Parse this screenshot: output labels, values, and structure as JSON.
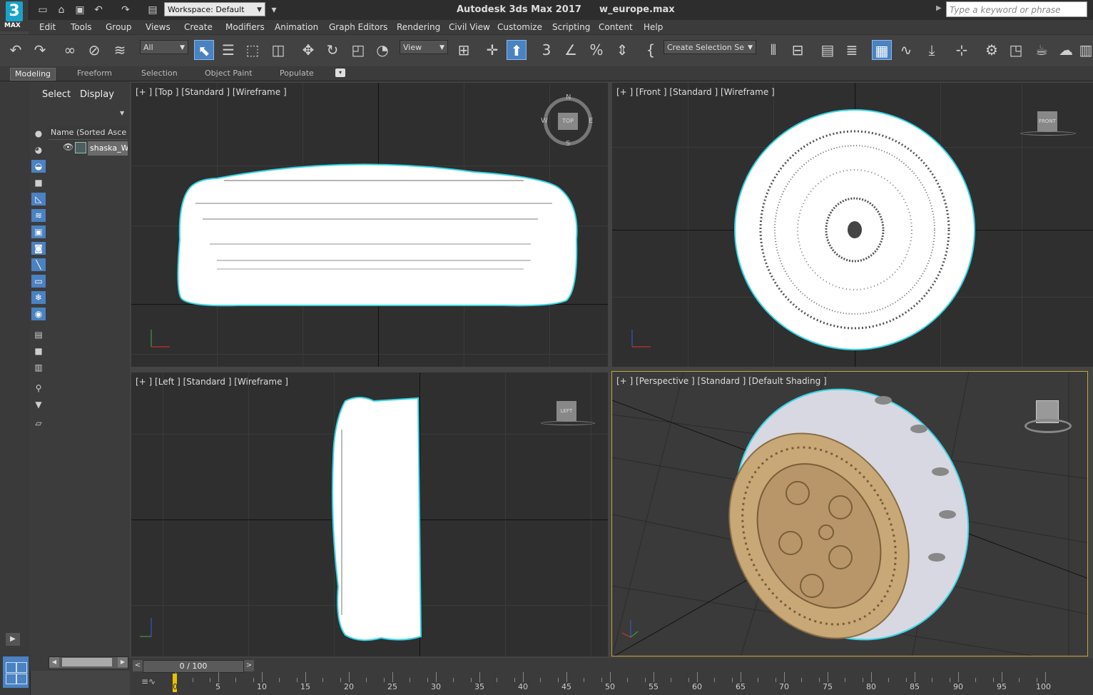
{
  "app": {
    "logo_number": "3",
    "logo_text": "MAX",
    "title": "Autodesk 3ds Max 2017",
    "filename": "w_europe.max",
    "workspace": "Workspace: Default",
    "search_placeholder": "Type a keyword or phrase"
  },
  "menu": [
    "Edit",
    "Tools",
    "Group",
    "Views",
    "Create",
    "Modifiers",
    "Animation",
    "Graph Editors",
    "Rendering",
    "Civil View",
    "Customize",
    "Scripting",
    "Content",
    "Help"
  ],
  "toolbar": {
    "filter": "All",
    "ref_coord": "View",
    "selection_set": "Create Selection Se"
  },
  "ribbon_tabs": [
    "Modeling",
    "Freeform",
    "Selection",
    "Object Paint",
    "Populate"
  ],
  "explorer": {
    "tabs": [
      "Select",
      "Display"
    ],
    "column_header": "Name (Sorted Ascendi",
    "objects": [
      "shaska_We"
    ]
  },
  "viewports": [
    {
      "label": "[+ ] [Top ] [Standard ] [Wireframe ]"
    },
    {
      "label": "[+ ] [Front ] [Standard ] [Wireframe ]"
    },
    {
      "label": "[+ ] [Left ] [Standard ] [Wireframe ]"
    },
    {
      "label": "[+ ] [Perspective ] [Standard ] [Default Shading ]"
    }
  ],
  "viewcube": {
    "top": "TOP",
    "front": "FRONT",
    "left": "LEFT",
    "compass": {
      "n": "N",
      "s": "S",
      "e": "E",
      "w": "W"
    }
  },
  "timeline": {
    "frame_display": "0 / 100",
    "current_frame": "0",
    "prev": "<",
    "next": ">",
    "ticks": [
      "5",
      "10",
      "15",
      "20",
      "25",
      "30",
      "35",
      "40",
      "45",
      "50",
      "55",
      "60",
      "65",
      "70",
      "75",
      "80",
      "85",
      "90",
      "95",
      "100"
    ]
  },
  "colors": {
    "selection_outline": "#35d6e6",
    "active_viewport_border": "#c8a23a",
    "object_gold": "#c9a878",
    "object_white": "#d8d8e2"
  }
}
